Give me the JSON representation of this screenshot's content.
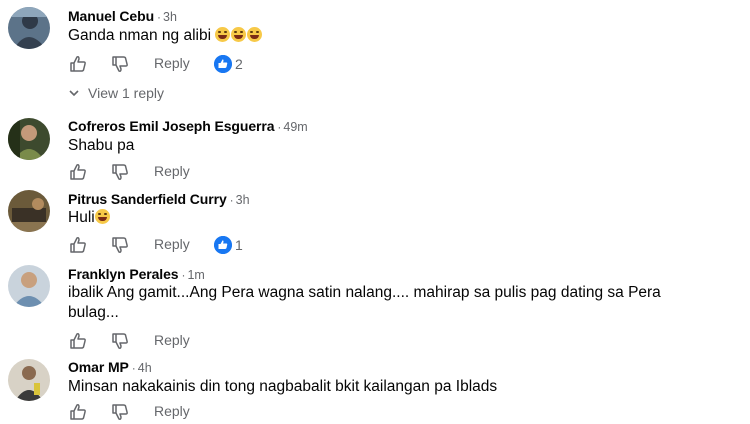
{
  "comments": [
    {
      "name": "Manuel Cebu",
      "time": "3h",
      "text": "Ganda nman ng alibi",
      "emoji_count": 3,
      "reply_label": "Reply",
      "reaction_count": "2",
      "view_replies": "View 1 reply"
    },
    {
      "name": "Cofreros Emil Joseph Esguerra",
      "time": "49m",
      "text": "Shabu pa",
      "reply_label": "Reply"
    },
    {
      "name": "Pitrus Sanderfield Curry",
      "time": "3h",
      "text": "Huli",
      "reply_label": "Reply",
      "reaction_count": "1"
    },
    {
      "name": "Franklyn Perales",
      "time": "1m",
      "text_line1": "ibalik Ang gamit...Ang Pera wagna satin nalang.... mahirap sa pulis pag dating sa Pera",
      "text_line2": "bulag...",
      "reply_label": "Reply"
    },
    {
      "name": "Omar MP",
      "time": "4h",
      "text": "Minsan nakakainis din tong nagbabalit bkit kailangan pa Iblads",
      "reply_label": "Reply"
    }
  ],
  "colors": {
    "text": "#050505",
    "secondary": "#65676b",
    "like_blue": "#1877f2"
  }
}
